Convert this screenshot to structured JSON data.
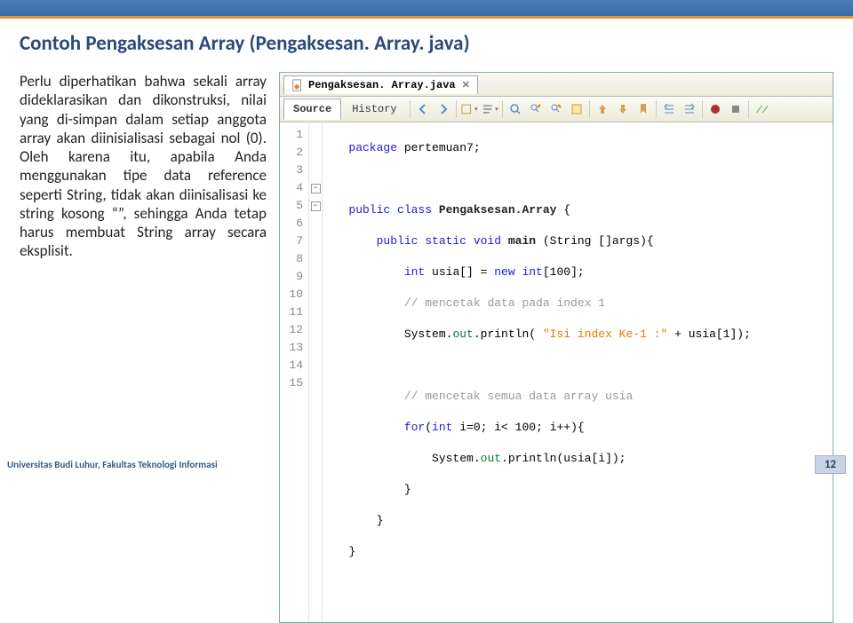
{
  "title": "Contoh Pengaksesan Array (Pengaksesan. Array. java)",
  "description": "Perlu diperhatikan bahwa sekali array dideklarasikan dan dikonstruksi, nilai yang di-simpan dalam setiap anggota array akan diinisialisasi sebagai nol (0). Oleh karena itu, apabila Anda menggunakan tipe data reference seperti String, tidak akan diinisalisasi ke string kosong “”, sehingga Anda tetap harus membuat String array secara eksplisit.",
  "editor": {
    "filename": "Pengaksesan. Array.java",
    "tabs": {
      "source": "Source",
      "history": "History"
    }
  },
  "code": {
    "l1": {
      "kw": "package",
      "rest": " pertemuan7;"
    },
    "l3a": "public class ",
    "l3b": "Pengaksesan.Array",
    "l3c": " {",
    "l4a": "public static void ",
    "l4b": "main",
    "l4c": " (String []args){",
    "l5a": "int",
    "l5b": " usia[] = ",
    "l5c": "new int",
    "l5d": "[100];",
    "l6": "// mencetak data pada index 1",
    "l7a": "System.",
    "l7b": "out",
    "l7c": ".println( ",
    "l7d": "\"Isi index Ke-1 :\"",
    "l7e": " + usia[1]);",
    "l9": "// mencetak semua data array usia",
    "l10a": "for",
    "l10b": "(",
    "l10c": "int",
    "l10d": " i=0; i< 100; i++){",
    "l11a": "System.",
    "l11b": "out",
    "l11c": ".println(usia[i]);",
    "l12": "}",
    "l13": "}",
    "l14": "}"
  },
  "lines": [
    "1",
    "2",
    "3",
    "4",
    "5",
    "6",
    "7",
    "8",
    "9",
    "10",
    "11",
    "12",
    "13",
    "14",
    "15"
  ],
  "footer": {
    "left": "Universitas Budi Luhur, Fakultas Teknologi Informasi",
    "page": "12"
  }
}
